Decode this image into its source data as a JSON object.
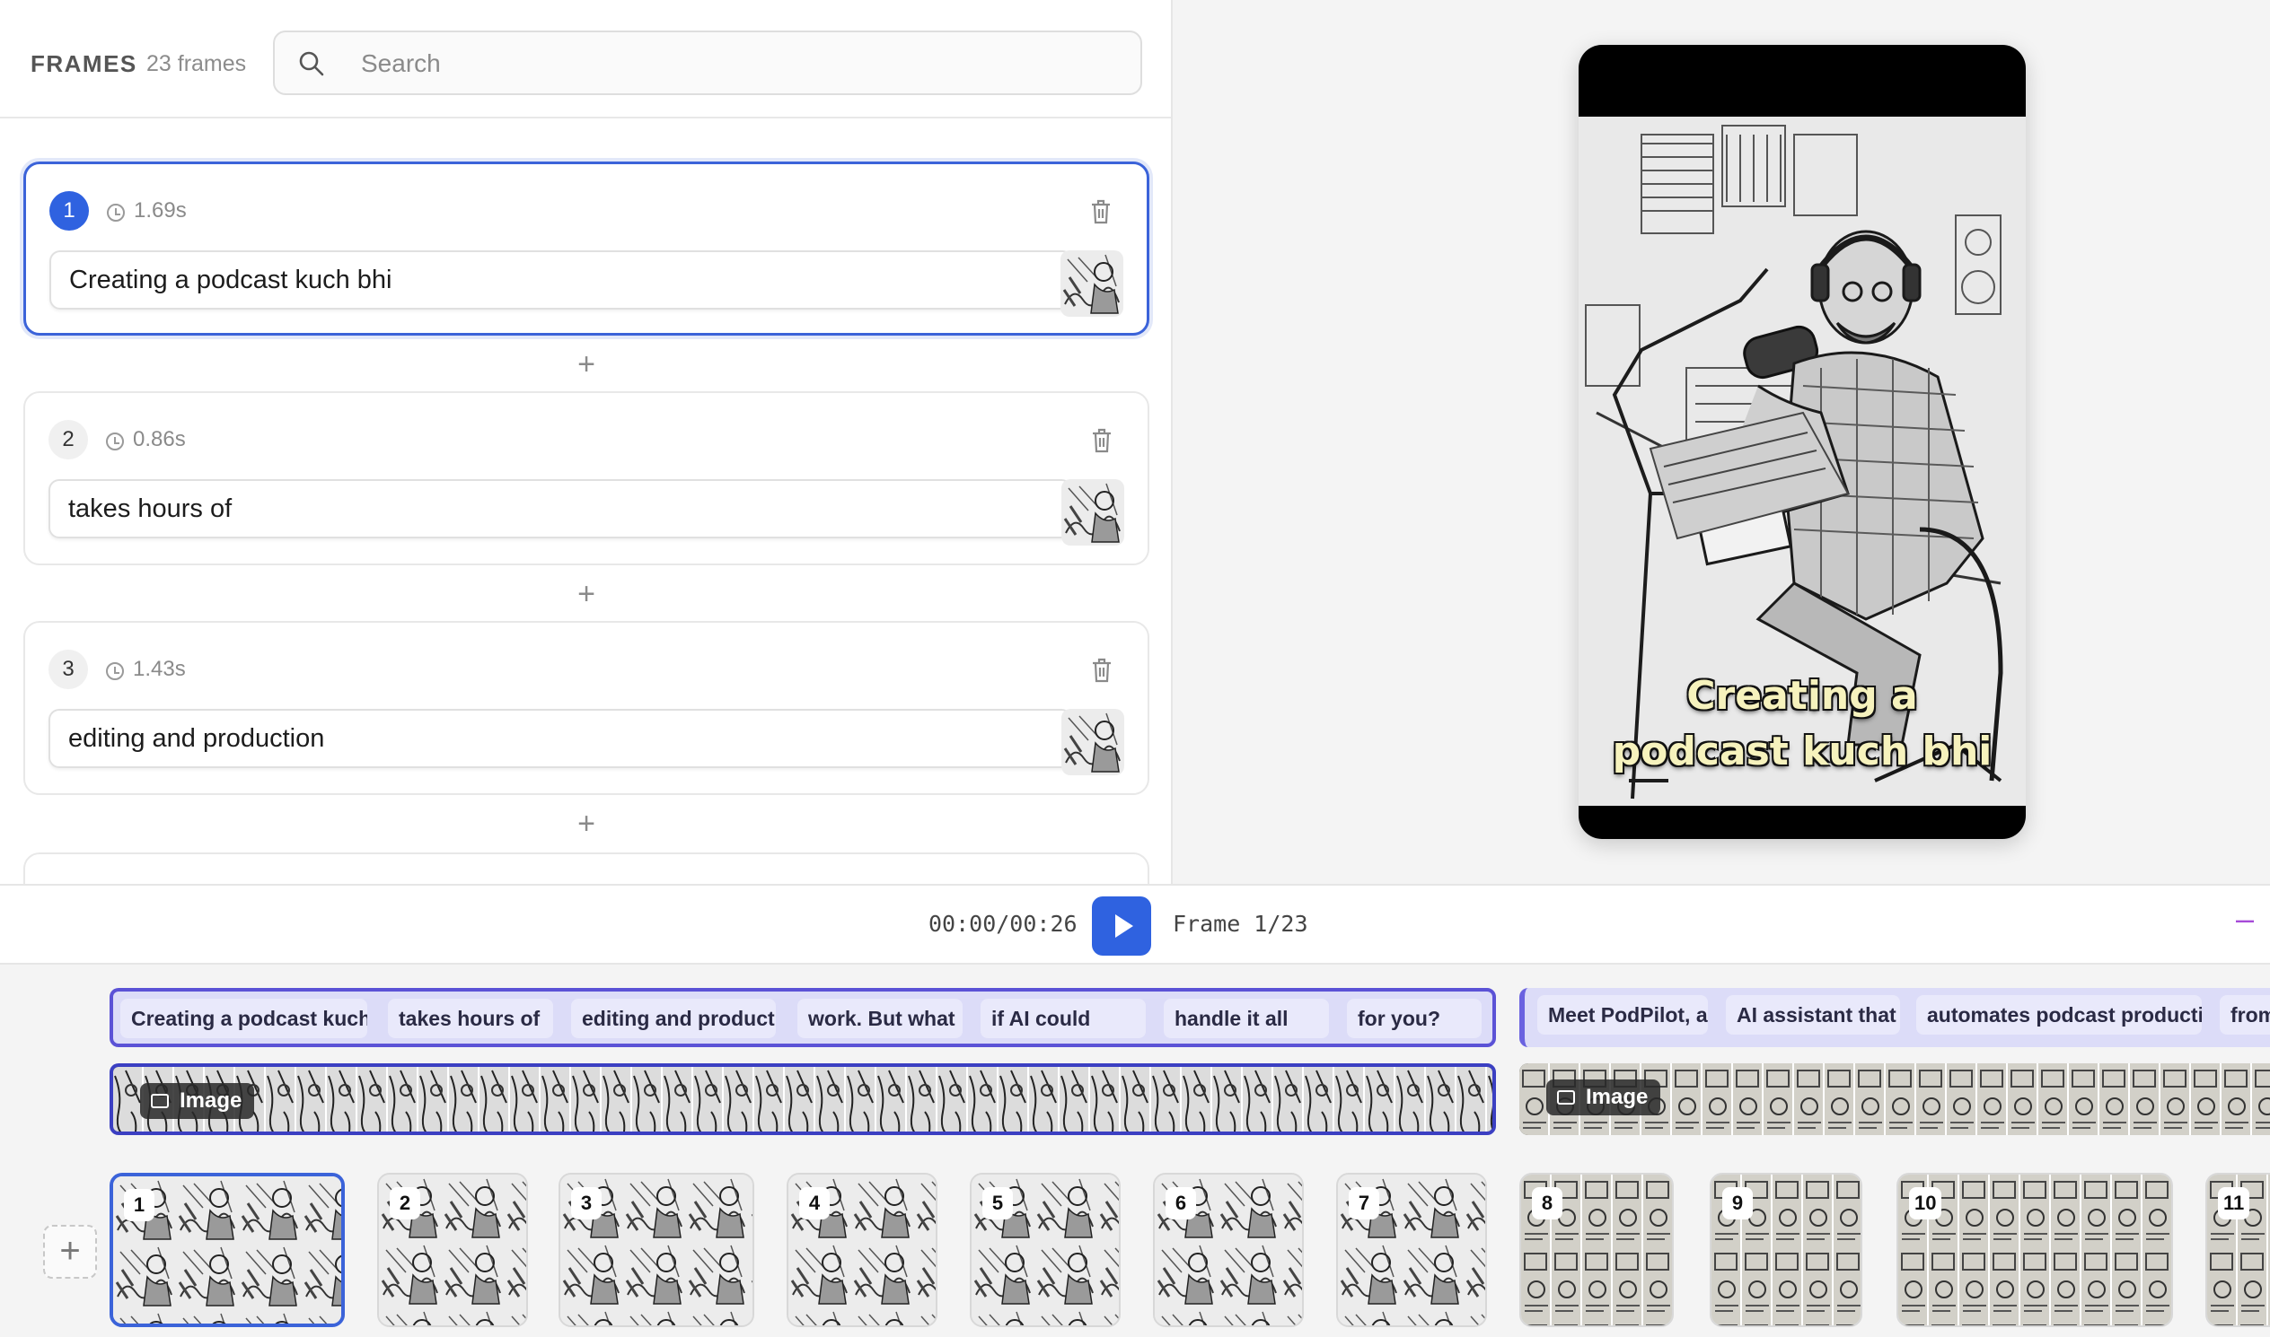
{
  "frames_panel": {
    "title": "FRAMES",
    "count": "23 frames",
    "search_placeholder": "Search",
    "frames": [
      {
        "number": "1",
        "duration": "1.69s",
        "text": "Creating a podcast kuch bhi"
      },
      {
        "number": "2",
        "duration": "0.86s",
        "text": "takes hours of"
      },
      {
        "number": "3",
        "duration": "1.43s",
        "text": "editing and production"
      }
    ]
  },
  "preview": {
    "caption": "Creating a podcast kuch bhi"
  },
  "playback": {
    "time": "00:00/00:26",
    "frame_indicator": "Frame 1/23"
  },
  "timeline": {
    "caption_group_1": [
      "Creating a podcast kuch bhi",
      "takes hours of",
      "editing and production",
      "work. But what",
      "if AI could",
      "handle it all",
      "for you?"
    ],
    "caption_group_2": [
      "Meet PodPilot, an",
      "AI assistant that",
      "automates podcast production",
      "from"
    ],
    "image_label": "Image",
    "thumbnails": [
      "1",
      "2",
      "3",
      "4",
      "5",
      "6",
      "7",
      "8",
      "9",
      "10",
      "11"
    ]
  },
  "colors": {
    "accent": "#2f62e0",
    "caption_track": "#dcdcf8",
    "caption_border": "#5b52d6",
    "caption_text": "#f6f2bd"
  },
  "icons": {
    "search": "search-icon",
    "clock": "clock-icon",
    "delete": "trash-icon",
    "play": "play-icon",
    "add": "plus-icon",
    "image": "image-icon"
  }
}
